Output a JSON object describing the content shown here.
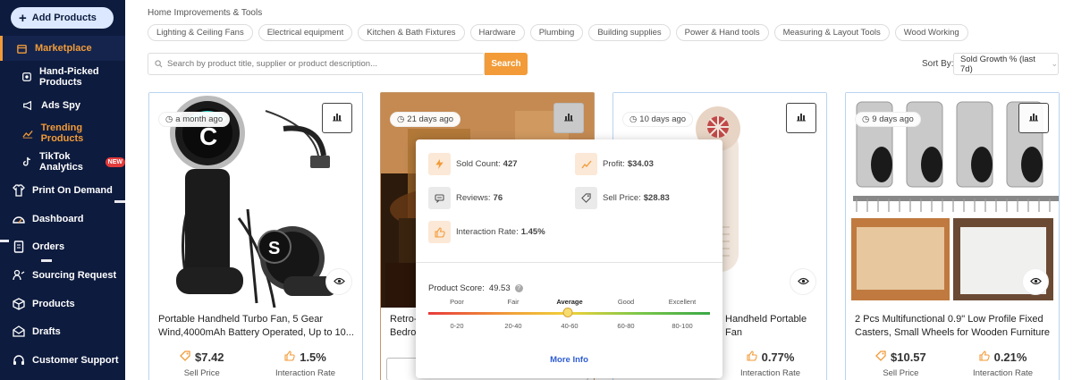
{
  "sidebar": {
    "add_label": "Add Products",
    "items": [
      {
        "label": "Marketplace",
        "icon": "store-icon"
      },
      {
        "label": "Hand-Picked Products",
        "icon": "hand-picked-icon"
      },
      {
        "label": "Ads Spy",
        "icon": "megaphone-icon"
      },
      {
        "label": "Trending Products",
        "icon": "trending-icon"
      },
      {
        "label": "TikTok Analytics",
        "icon": "tiktok-icon",
        "badge": "NEW"
      },
      {
        "label": "Print On Demand",
        "icon": "shirt-icon"
      },
      {
        "label": "Dashboard",
        "icon": "dashboard-icon"
      },
      {
        "label": "Orders",
        "icon": "orders-icon"
      },
      {
        "label": "Sourcing Request",
        "icon": "sourcing-icon"
      },
      {
        "label": "Products",
        "icon": "box-icon"
      },
      {
        "label": "Drafts",
        "icon": "drafts-icon"
      },
      {
        "label": "Customer Support",
        "icon": "headset-icon"
      }
    ]
  },
  "breadcrumb": "Home Improvements & Tools",
  "categories": [
    "Lighting & Ceiling Fans",
    "Electrical equipment",
    "Kitchen & Bath Fixtures",
    "Hardware",
    "Plumbing",
    "Building supplies",
    "Power & Hand tools",
    "Measuring & Layout Tools",
    "Wood Working"
  ],
  "search": {
    "placeholder": "Search by product title, supplier or product description...",
    "button": "Search"
  },
  "sort": {
    "label": "Sort By:",
    "value": "Sold Growth % (last 7d)"
  },
  "cards": [
    {
      "ago": "a month ago",
      "title": "Portable Handheld Turbo Fan, 5 Gear Wind,4000mAh Battery Operated, Up to 10...",
      "price": "$7.42",
      "price_label": "Sell Price",
      "rate": "1.5%",
      "rate_label": "Interaction Rate"
    },
    {
      "ago": "21 days ago",
      "title_a": "Retro-",
      "title_b": "Bedroo"
    },
    {
      "ago": "10 days ago",
      "title": "Handheld Portable Fan",
      "rate": "0.77%",
      "rate_label": "Interaction Rate"
    },
    {
      "ago": "9 days ago",
      "title": "2 Pcs Multifunctional 0.9\" Low Profile Fixed Casters, Small Wheels for Wooden Furniture &...",
      "price": "$10.57",
      "price_label": "Sell Price",
      "rate": "0.21%",
      "rate_label": "Interaction Rate"
    }
  ],
  "popup": {
    "sold_label": "Sold Count:",
    "sold": "427",
    "profit_label": "Profit:",
    "profit": "$34.03",
    "reviews_label": "Reviews:",
    "reviews": "76",
    "sellprice_label": "Sell Price:",
    "sellprice": "$28.83",
    "interaction_label": "Interaction Rate:",
    "interaction": "1.45%",
    "score_label": "Product Score:",
    "score": "49.53",
    "score_fraction": 0.4953,
    "levels": [
      "Poor",
      "Fair",
      "Average",
      "Good",
      "Excellent"
    ],
    "ranges": [
      "0-20",
      "20-40",
      "40-60",
      "60-80",
      "80-100"
    ],
    "more": "More Info"
  },
  "colors": {
    "sidebar": "#0d1b3e",
    "accent": "#f29b38",
    "link": "#2f5dd1"
  }
}
